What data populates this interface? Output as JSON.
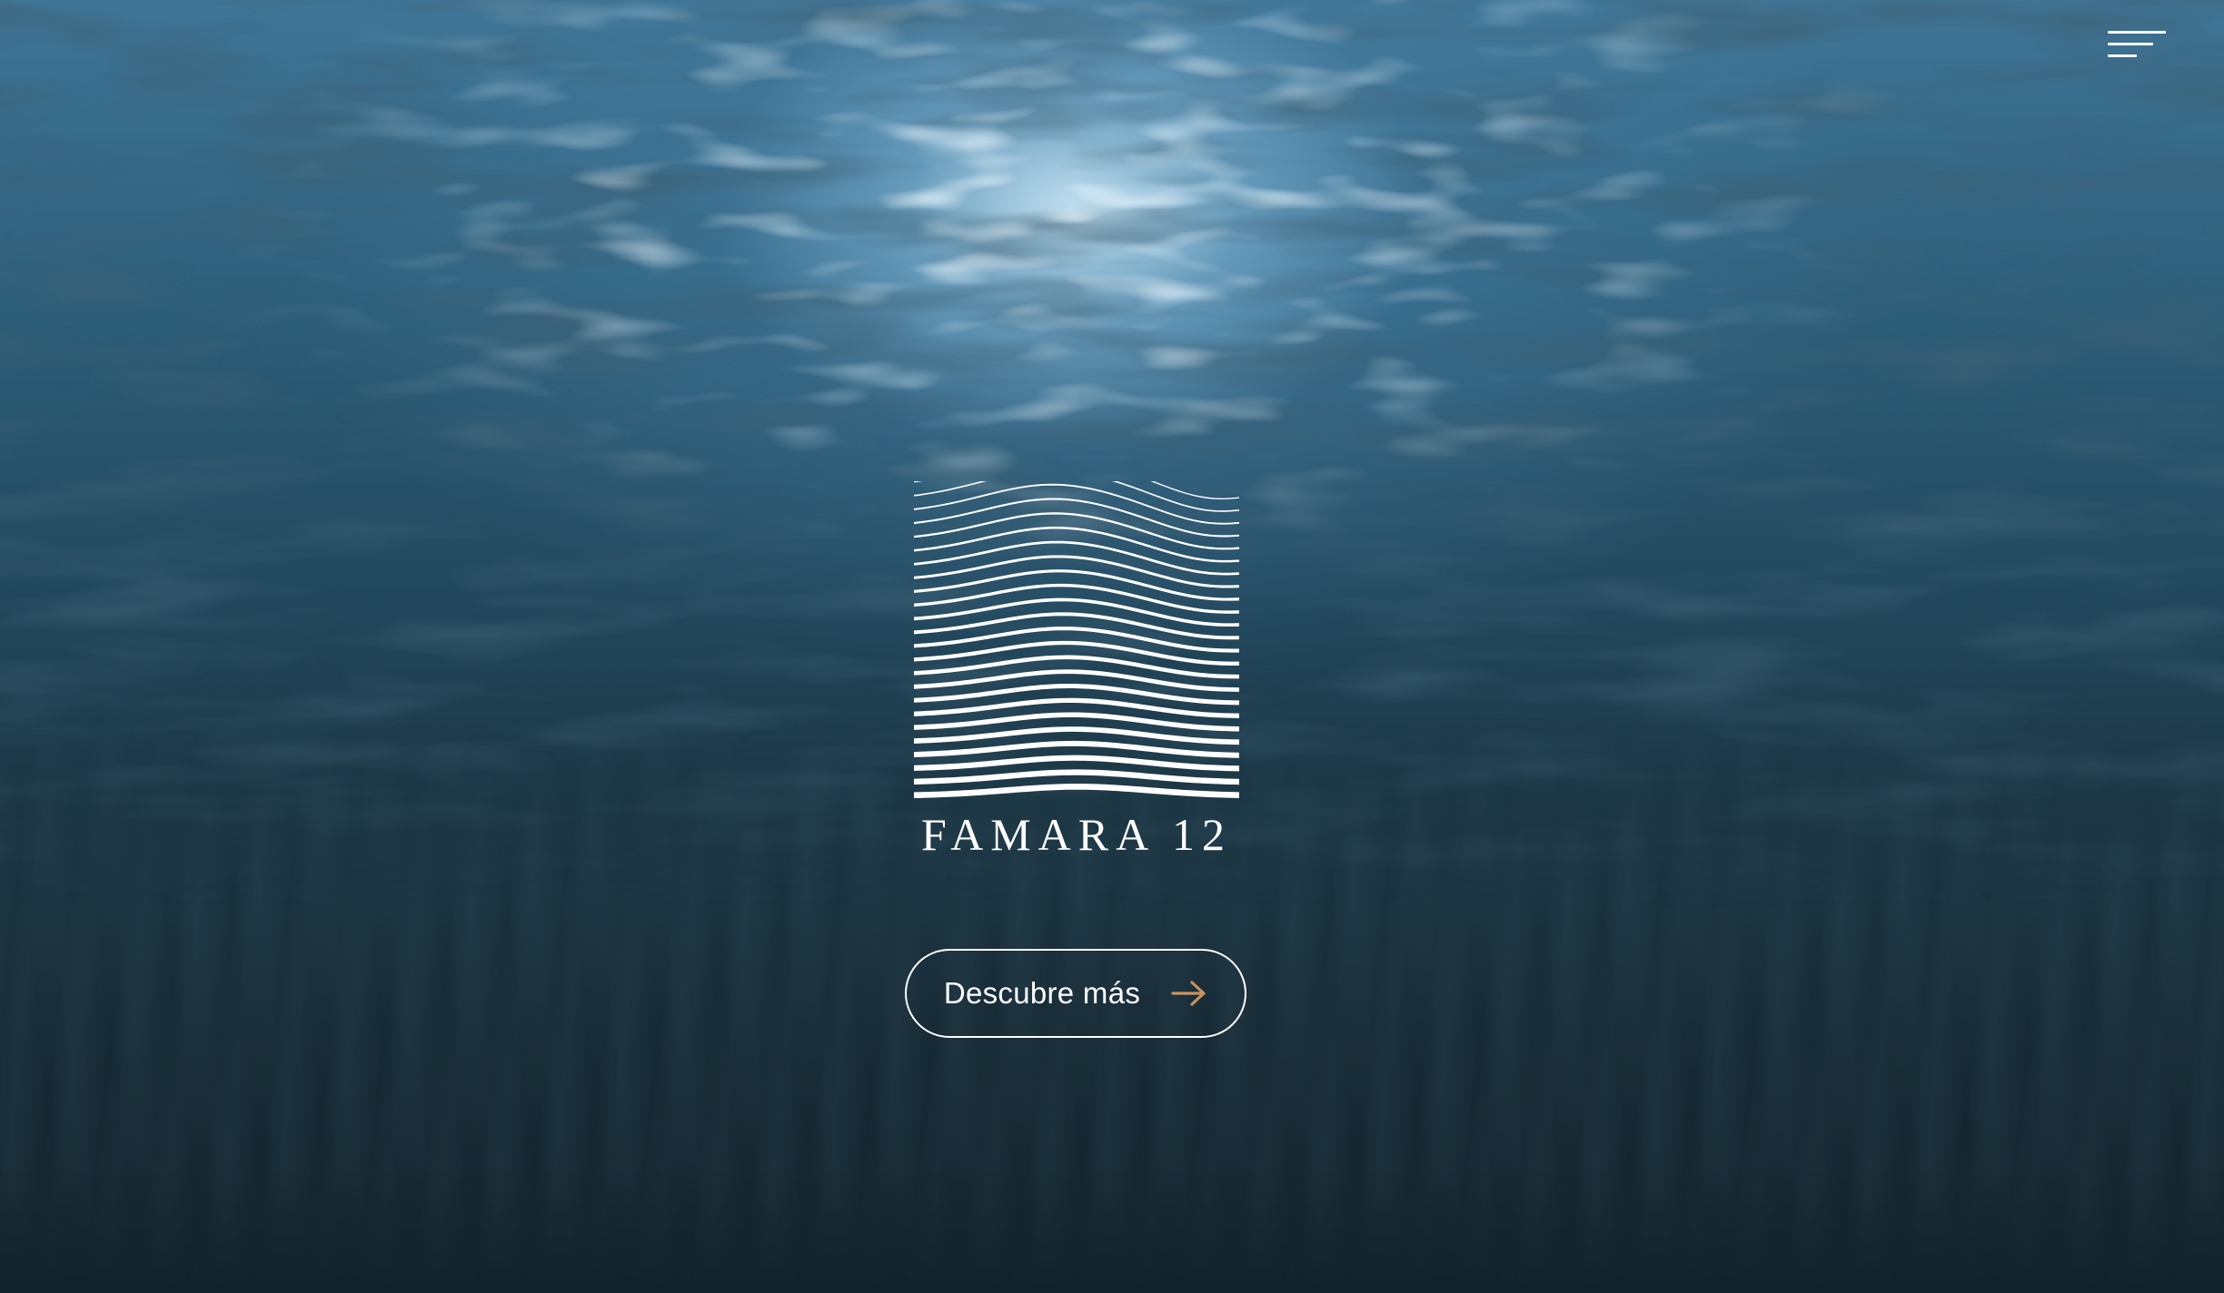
{
  "header": {
    "menu_icon": "hamburger-menu-icon"
  },
  "hero": {
    "background": "underwater-sea-surface",
    "logo": {
      "mark_icon": "wave-lines-logo",
      "text": "FAMARA 12"
    },
    "cta": {
      "label": "Descubre más",
      "icon": "arrow-right-icon"
    }
  },
  "colors": {
    "text": "#ffffff",
    "accent": "#c9925f",
    "deep_water": "#14252f"
  }
}
